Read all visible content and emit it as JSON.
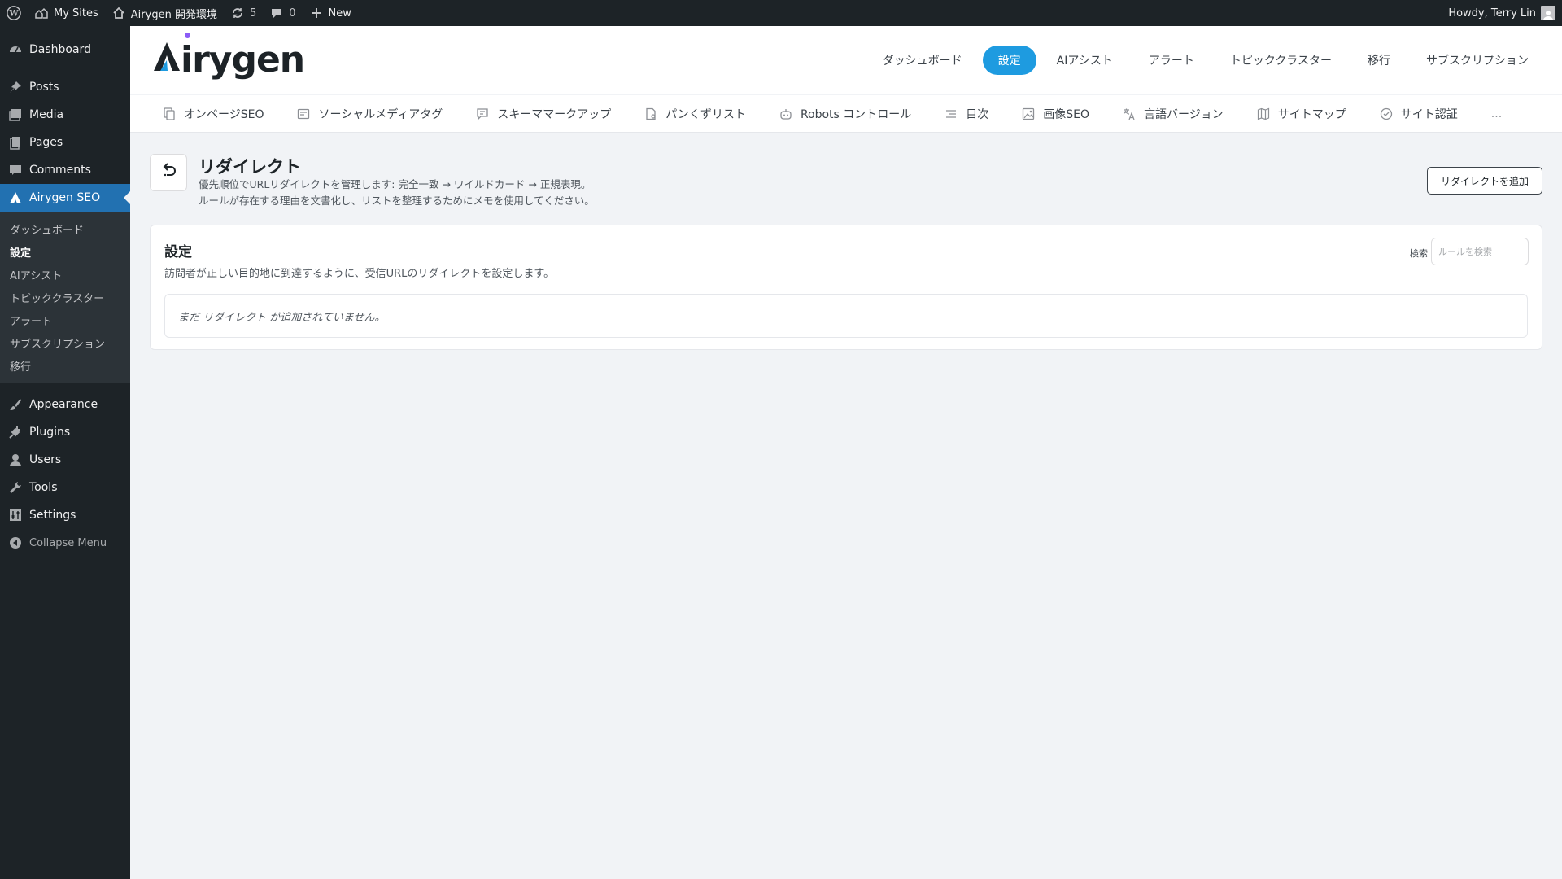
{
  "adminbar": {
    "my_sites": "My Sites",
    "site_name": "Airygen 開発環境",
    "updates_count": "5",
    "comments_count": "0",
    "new_label": "New",
    "howdy": "Howdy, Terry Lin"
  },
  "sidebar": {
    "dashboard": "Dashboard",
    "posts": "Posts",
    "media": "Media",
    "pages": "Pages",
    "comments": "Comments",
    "airygen": "Airygen SEO",
    "submenu": [
      "ダッシュボード",
      "設定",
      "AIアシスト",
      "トピッククラスター",
      "アラート",
      "サブスクリプション",
      "移行"
    ],
    "appearance": "Appearance",
    "plugins": "Plugins",
    "users": "Users",
    "tools": "Tools",
    "settings": "Settings",
    "collapse": "Collapse Menu"
  },
  "header": {
    "logo_text": "irygen",
    "nav": [
      "ダッシュボード",
      "設定",
      "AIアシスト",
      "アラート",
      "トピッククラスター",
      "移行",
      "サブスクリプション"
    ],
    "active_nav": "設定",
    "accent_color": "#1e9be0"
  },
  "tabs": [
    {
      "label": "オンページSEO",
      "icon": "page-copy-icon"
    },
    {
      "label": "ソーシャルメディアタグ",
      "icon": "share-card-icon"
    },
    {
      "label": "スキーママークアップ",
      "icon": "schema-icon"
    },
    {
      "label": "パンくずリスト",
      "icon": "breadcrumb-icon"
    },
    {
      "label": "Robots コントロール",
      "icon": "robot-icon"
    },
    {
      "label": "目次",
      "icon": "list-icon"
    },
    {
      "label": "画像SEO",
      "icon": "image-icon"
    },
    {
      "label": "言語バージョン",
      "icon": "translate-icon"
    },
    {
      "label": "サイトマップ",
      "icon": "map-icon"
    },
    {
      "label": "サイト認証",
      "icon": "verified-icon"
    }
  ],
  "tabs_more": "...",
  "page": {
    "title": "リダイレクト",
    "desc_line1": "優先順位でURLリダイレクトを管理します: 完全一致 → ワイルドカード → 正規表現。",
    "desc_line2": "ルールが存在する理由を文書化し、リストを整理するためにメモを使用してください。",
    "add_button": "リダイレクトを追加"
  },
  "card": {
    "title": "設定",
    "desc": "訪問者が正しい目的地に到達するように、受信URLのリダイレクトを設定します。",
    "search_label": "検索",
    "search_placeholder": "ルールを検索",
    "empty_text": "まだ リダイレクト が追加されていません。"
  }
}
